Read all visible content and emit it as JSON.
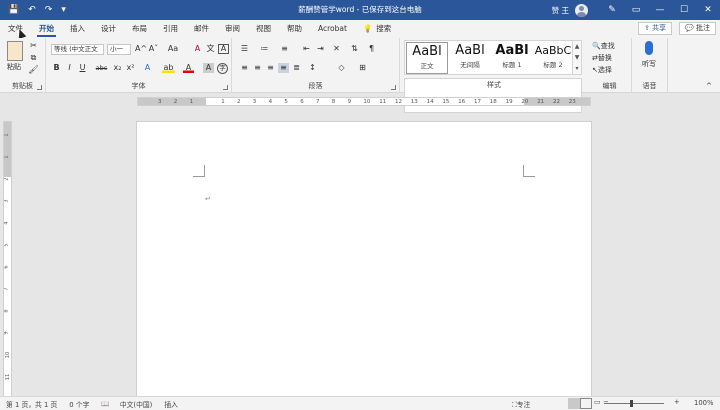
{
  "titlebar": {
    "doc_title": "薪酬赞管学word - 已保存到这台电脑",
    "user_name": "赞 王",
    "qat": {
      "save": "💾",
      "undo": "↶",
      "redo": "↷",
      "customize": "▾"
    },
    "controls": {
      "pen": "✎",
      "ribbon_opt": "▭",
      "minimize": "—",
      "maximize": "☐",
      "close": "✕"
    }
  },
  "tabs": [
    "文件",
    "开始",
    "插入",
    "设计",
    "布局",
    "引用",
    "邮件",
    "审阅",
    "视图",
    "帮助",
    "Acrobat"
  ],
  "active_tab": "开始",
  "search_label": "搜索",
  "share_label": "共享",
  "comment_label": "批注",
  "clipboard": {
    "paste": "粘贴",
    "group": "剪贴板"
  },
  "font": {
    "name": "等线 (中文正文",
    "size": "小一",
    "group": "字体",
    "btns": {
      "bold": "B",
      "italic": "I",
      "underline": "U",
      "strike": "abc",
      "sub": "x₂",
      "sup": "x²",
      "grow": "A^",
      "shrink": "Aˇ",
      "case": "Aa",
      "clear": "A",
      "phonetic": "文",
      "border": "A",
      "effect": "A",
      "highlight": "ab",
      "color": "A",
      "shade": "A",
      "circle": "字"
    }
  },
  "paragraph": {
    "group": "段落"
  },
  "styles": {
    "group": "样式",
    "items": [
      {
        "preview": "AaBl",
        "name": "正文"
      },
      {
        "preview": "AaBl",
        "name": "无间隔"
      },
      {
        "preview": "AaBl",
        "name": "标题 1"
      },
      {
        "preview": "AaBbC",
        "name": "标题 2"
      }
    ]
  },
  "editing": {
    "find": "查找",
    "replace": "替换",
    "select": "选择",
    "group": "编辑"
  },
  "voice": {
    "dictate": "听写",
    "group": "语音"
  },
  "ruler_numbers": [
    "3",
    "2",
    "1",
    "",
    "1",
    "2",
    "3",
    "4",
    "5",
    "6",
    "7",
    "8",
    "9",
    "10",
    "11",
    "12",
    "13",
    "14",
    "15",
    "16",
    "17",
    "18",
    "19",
    "20",
    "21",
    "22",
    "23"
  ],
  "vruler_numbers": [
    "1",
    "1",
    "2",
    "3",
    "4",
    "5",
    "6",
    "7",
    "8",
    "9",
    "10",
    "11"
  ],
  "page": {
    "paragraph_mark": "↵"
  },
  "statusbar": {
    "page": "第 1 页，共 1 页",
    "words": "0 个字",
    "lang": "中文(中国)",
    "mode": "插入",
    "focus": "专注",
    "zoom": "100%"
  }
}
